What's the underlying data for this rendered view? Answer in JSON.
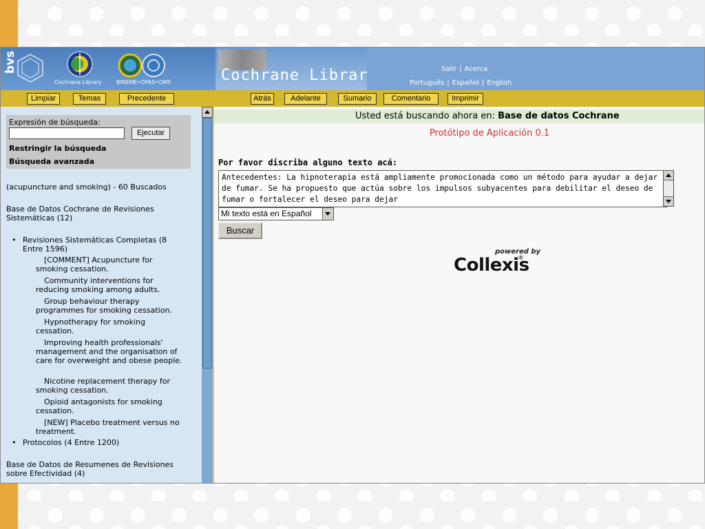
{
  "header": {
    "bvs": "bvs",
    "cochrane_library_label": "Cochrane Library",
    "bireme_label": "BIREME•OPAS•OMS",
    "title": "Cochrane Library",
    "top_links": [
      "Salir",
      "Acerca"
    ],
    "lang_links": [
      "Português",
      "Español",
      "English"
    ]
  },
  "toolbar": {
    "left_buttons": [
      "Limpiar",
      "Temas",
      "Precedente"
    ],
    "right_buttons": [
      "Atrás",
      "Adelante",
      "Sumario",
      "Comentario",
      "Imprimir"
    ]
  },
  "sidebar": {
    "search_label": "Expresión de búsqueda:",
    "search_value": "",
    "execute_label": "Ejecutar",
    "restrict_label": "Restringir la búsqueda",
    "advanced_label": "Búsqueda avanzada",
    "query_summary": "(acupuncture and smoking) - 60 Buscados",
    "db_title": "Base de Datos Cochrane de Revisiones Sistemáticas (12)",
    "complete_reviews": "Revisiones Sistemáticas Completas (8 Entre 1596)",
    "entries": [
      "[COMMENT] Acupuncture for smoking cessation.",
      "Community interventions for reducing smoking among adults.",
      "Group behaviour therapy programmes for smoking cessation.",
      "Hypnotherapy for smoking cessation.",
      "Improving health professionals' management and the organisation of care for overweight and obese people.",
      "Nicotine replacement therapy for smoking cessation.",
      "Opioid antagonists for smoking cessation.",
      "[NEW] Placebo treatment versus no treatment."
    ],
    "protocols": "Protocolos (4 Entre 1200)",
    "db2_title": "Base de Datos de Resumenes de Revisiones sobre Efectividad (4)"
  },
  "main": {
    "status_label": "Usted está buscando ahora en:",
    "status_value": "Base de datos Cochrane",
    "prototype": "Protótipo de Aplicación 0.1",
    "prompt": "Por favor discriba alguno texto acá:",
    "text_value": "Antecedentes: La hipnoterapia está ampliamente promocionada como un método para ayudar a dejar de fumar. Se ha propuesto que actúa sobre los impulsos subyacentes para debilitar el deseo de fumar o fortalecer el deseo para dejar",
    "language_select": "Mi texto está en Español",
    "search_button": "Buscar",
    "powered_by": "powered by",
    "brand": "Collexis",
    "registered": "®"
  },
  "colors": {
    "header_blue": "#5f8fc7",
    "toolbar_gold": "#d6b82e",
    "sidebar_blue": "#d6e6f3",
    "prototype_red": "#d03030"
  }
}
